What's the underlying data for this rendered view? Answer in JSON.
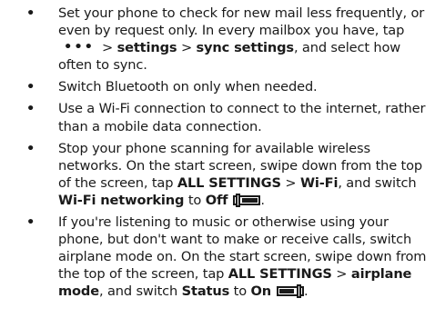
{
  "bullet_char": "•",
  "tips": [
    {
      "a": "Set your phone to check for new mail less frequently, or even by request only. In every mailbox you have, tap",
      "more_icon": "•••",
      "b": ">",
      "c": "settings",
      "d": ">",
      "e": "sync settings",
      "f": ", and select how often to sync."
    },
    {
      "a": "Switch Bluetooth on only when needed."
    },
    {
      "a": "Use a Wi-Fi connection to connect to the internet, rather than a mobile data connection."
    },
    {
      "a": "Stop your phone scanning for available wireless networks. On the start screen, swipe down from the top of the screen, tap",
      "b": "ALL SETTINGS",
      "c": ">",
      "d": "Wi-Fi",
      "e": ", and switch",
      "f": "Wi-Fi networking",
      "g": "to",
      "h": "Off",
      "i": "."
    },
    {
      "a": "If you're listening to music or otherwise using your phone, but don't want to make or receive calls, switch airplane mode on. On the start screen, swipe down from the top of the screen, tap",
      "b": "ALL SETTINGS",
      "c": ">",
      "d": "airplane mode",
      "e": ", and switch",
      "f": "Status",
      "g": "to",
      "h": "On",
      "i": "."
    }
  ],
  "icons": {
    "more": "more-dots-icon",
    "toggle_off": "toggle-off-icon",
    "toggle_on": "toggle-on-icon"
  },
  "colors": {
    "text": "#1a1a1a",
    "background": "#ffffff"
  }
}
